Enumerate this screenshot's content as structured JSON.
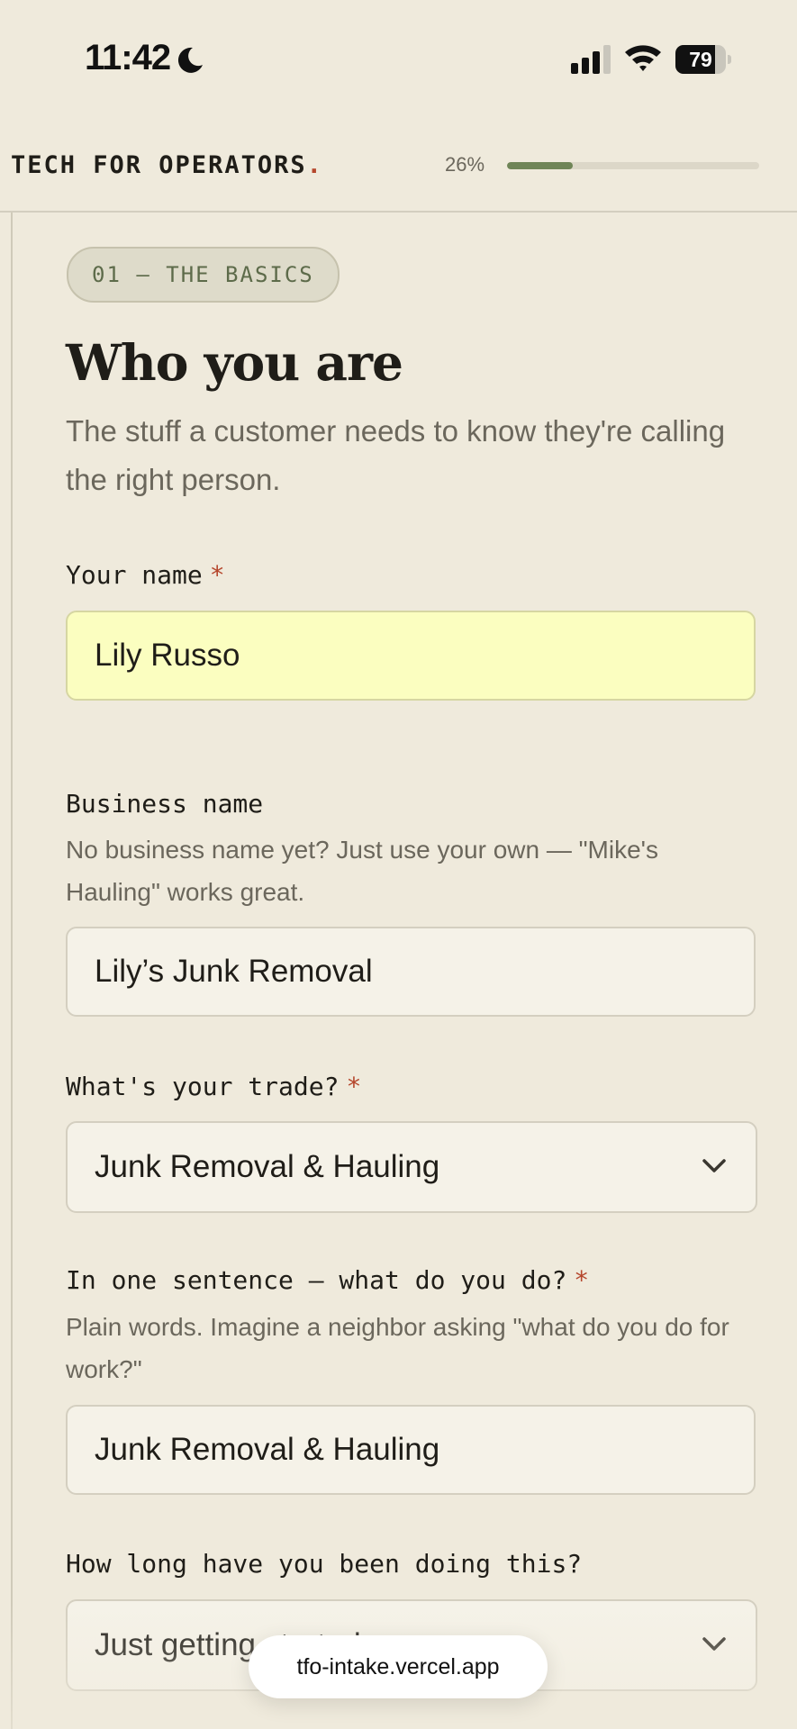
{
  "status_bar": {
    "time": "11:42",
    "battery": "79",
    "battery_level": 0.79
  },
  "header": {
    "brand": "TECH FOR OPERATORS",
    "brand_dot": ".",
    "progress_label": "26%",
    "progress_value": 0.26
  },
  "section": {
    "pill": "01 — THE BASICS",
    "title": "Who you are",
    "subtitle": "The stuff a customer needs to know they're calling the right person."
  },
  "fields": {
    "name": {
      "label": "Your name",
      "required_mark": "*",
      "value": "Lily Russo"
    },
    "business": {
      "label": "Business name",
      "hint": "No business name yet? Just use your own — \"Mike's Hauling\" works great.",
      "value": "Lily’s Junk Removal"
    },
    "trade": {
      "label": "What's your trade?",
      "required_mark": "*",
      "value": "Junk Removal & Hauling"
    },
    "sentence": {
      "label": "In one sentence — what do you do?",
      "required_mark": "*",
      "hint": "Plain words. Imagine a neighbor asking \"what do you do for work?\"",
      "value": "Junk Removal & Hauling"
    },
    "duration": {
      "label": "How long have you been doing this?",
      "value": "Just getting started"
    }
  },
  "browser": {
    "url": "tfo-intake.vercel.app"
  },
  "colors": {
    "background": "#efeadc",
    "accent_green": "#6f8557",
    "required_red": "#b5462c",
    "highlight_input": "#fbfec0"
  },
  "icons": {
    "moon": "moon-icon",
    "signal": "cellular-signal-icon",
    "wifi": "wifi-icon",
    "battery": "battery-icon",
    "chevron": "chevron-down-icon"
  }
}
